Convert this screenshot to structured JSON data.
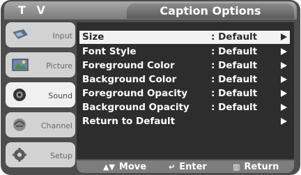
{
  "header": {
    "device_label": "T V",
    "menu_title": "Caption Options"
  },
  "sidebar": {
    "items": [
      {
        "label": "Input",
        "icon": "input-icon"
      },
      {
        "label": "Picture",
        "icon": "picture-icon"
      },
      {
        "label": "Sound",
        "icon": "sound-icon"
      },
      {
        "label": "Channel",
        "icon": "channel-icon"
      },
      {
        "label": "Setup",
        "icon": "setup-icon"
      }
    ]
  },
  "menu": {
    "rows": [
      {
        "label": "Size",
        "value": ": Default",
        "selected": true
      },
      {
        "label": "Font Style",
        "value": ": Default"
      },
      {
        "label": "Foreground Color",
        "value": ": Default"
      },
      {
        "label": "Background Color",
        "value": ": Default"
      },
      {
        "label": "Foreground Opacity",
        "value": ": Default"
      },
      {
        "label": "Background Opacity",
        "value": ": Default"
      },
      {
        "label": "Return to Default",
        "value": ""
      }
    ]
  },
  "footer": {
    "move": "Move",
    "enter": "Enter",
    "return": "Return"
  }
}
